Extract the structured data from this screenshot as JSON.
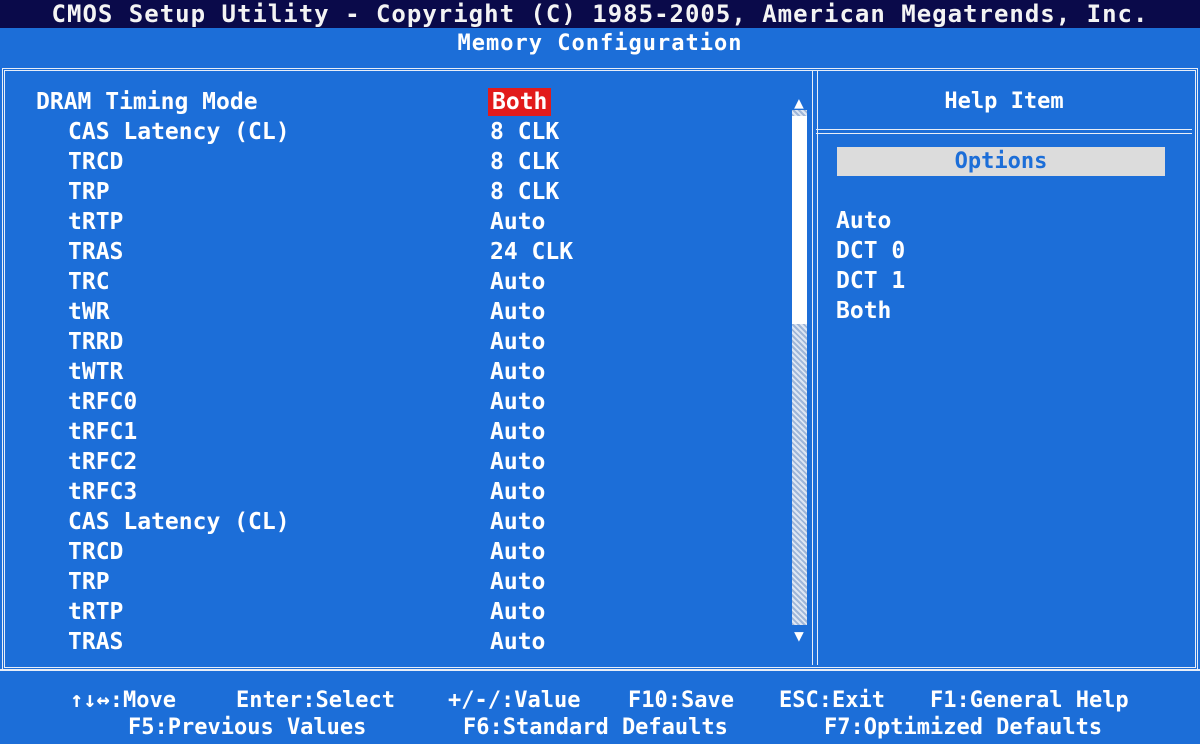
{
  "app_title": "CMOS Setup Utility - Copyright (C) 1985-2005, American Megatrends, Inc.",
  "page_title": "Memory Configuration",
  "settings": [
    {
      "label": "DRAM Timing Mode",
      "value": "Both"
    },
    {
      "label": "CAS Latency (CL)",
      "value": "8 CLK"
    },
    {
      "label": "TRCD",
      "value": "8 CLK"
    },
    {
      "label": "TRP",
      "value": "8 CLK"
    },
    {
      "label": "tRTP",
      "value": "Auto"
    },
    {
      "label": "TRAS",
      "value": "24 CLK"
    },
    {
      "label": "TRC",
      "value": "Auto"
    },
    {
      "label": "tWR",
      "value": "Auto"
    },
    {
      "label": "TRRD",
      "value": "Auto"
    },
    {
      "label": "tWTR",
      "value": "Auto"
    },
    {
      "label": "tRFC0",
      "value": "Auto"
    },
    {
      "label": "tRFC1",
      "value": "Auto"
    },
    {
      "label": "tRFC2",
      "value": "Auto"
    },
    {
      "label": "tRFC3",
      "value": "Auto"
    },
    {
      "label": "CAS Latency (CL)",
      "value": "Auto"
    },
    {
      "label": "TRCD",
      "value": "Auto"
    },
    {
      "label": "TRP",
      "value": "Auto"
    },
    {
      "label": "tRTP",
      "value": "Auto"
    },
    {
      "label": "TRAS",
      "value": "Auto"
    }
  ],
  "scroll": {
    "up_icon": "▲",
    "down_icon": "▼"
  },
  "help": {
    "title": "Help Item",
    "options_label": "Options",
    "options": [
      "Auto",
      "DCT 0",
      "DCT 1",
      "Both"
    ]
  },
  "footer": {
    "move": "↑↓↔:Move",
    "select": "Enter:Select",
    "value": "+/-/:Value",
    "save": "F10:Save",
    "exit": "ESC:Exit",
    "help": "F1:General Help",
    "previous": "F5:Previous Values",
    "standard": "F6:Standard Defaults",
    "optimized": "F7:Optimized Defaults"
  },
  "colors": {
    "background": "#1c6ed8",
    "title_bar": "#0a0a4a",
    "selection": "#e21b1b",
    "text": "#ffffff"
  }
}
